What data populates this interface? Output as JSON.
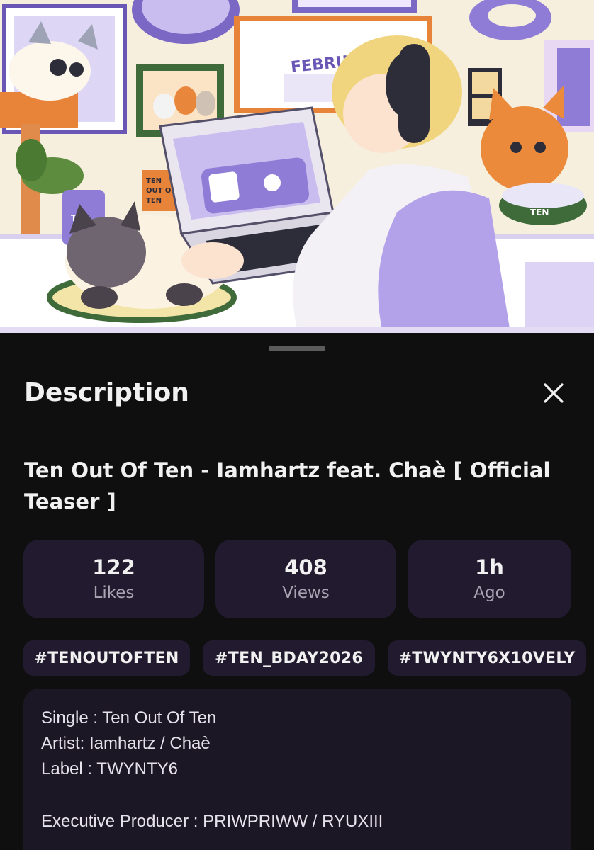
{
  "header": {
    "title": "Description",
    "close_icon": "close-icon"
  },
  "thumbnail": {
    "calendar_text": "FEBRUARY",
    "sign_text": "TEN\nOUT OF\nTEN",
    "mug_text": "Ten",
    "bowl_text": "TEN"
  },
  "video": {
    "title": "Ten Out Of Ten -  Iamhartz feat. Chaè [ Official Teaser ]"
  },
  "stats": [
    {
      "number": "122",
      "label": "Likes"
    },
    {
      "number": "408",
      "label": "Views"
    },
    {
      "number": "1h",
      "label": "Ago"
    }
  ],
  "tags": [
    "#TENOUTOFTEN",
    "#TEN_BDAY2026",
    "#TWYNTY6X10VELY"
  ],
  "description": {
    "lines": [
      "Single : Ten Out Of Ten",
      "Artist: Iamhartz / Chaè",
      "Label : TWYNTY6",
      "Executive Producer : PRIWPRIWW / RYUXIII"
    ]
  },
  "colors": {
    "background": "#0f0f0f",
    "card": "#221a2e",
    "accent_purple": "#8e7cd6"
  }
}
